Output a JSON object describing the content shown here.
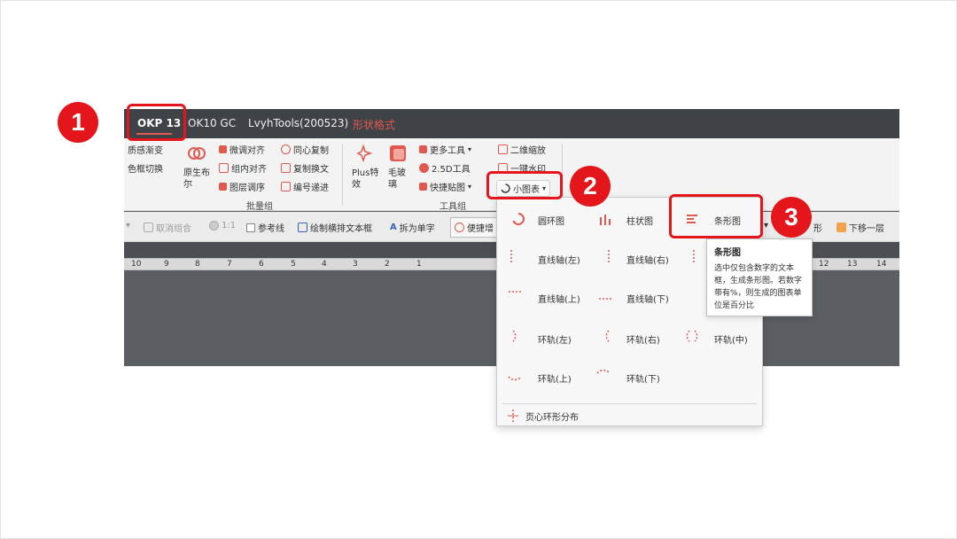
{
  "tabs": {
    "okp": "OKP 13",
    "ok10": "OK10 GC",
    "lvyh": "LvyhTools(200523)",
    "shape": "形状格式"
  },
  "ribbon": {
    "texture": "质感渐变",
    "color_switch": "色框切换",
    "yuansheng": "原生布尔",
    "fine_align": "微调对齐",
    "group_align": "组内对齐",
    "layer_order": "图层调序",
    "concentric_copy": "同心复制",
    "copy_wrap": "复制换文",
    "number_inc": "编号递进",
    "batch_group": "批量组",
    "plus_effect": "Plus特效",
    "frosted": "毛玻璃",
    "more_tools": "更多工具",
    "tool_25d": "2.5D工具",
    "quick_shot": "快捷贴图",
    "qr_zoom": "二维缩放",
    "one_click_watermark": "一键水印",
    "mini_chart": "小图表",
    "tool_group": "工具组"
  },
  "toolbar2": {
    "ungroup": "取消组合",
    "ratio": "1:1",
    "guide": "参考线",
    "draw_textbox": "绘制横排文本框",
    "split_chars": "拆为单字",
    "quick_add": "便捷增",
    "shape_suffix": "形",
    "move_down": "下移一层"
  },
  "ruler": [
    "10",
    "9",
    "8",
    "7",
    "6",
    "5",
    "4",
    "3",
    "2",
    "1",
    "12",
    "13",
    "14"
  ],
  "dropdown": {
    "items": [
      "圆环图",
      "柱状图",
      "条形图",
      "直线轴(左)",
      "直线轴(右)",
      "直线轴(上)",
      "直线轴(下)",
      "环轨(左)",
      "环轨(右)",
      "环轨(中)",
      "环轨(上)",
      "环轨(下)"
    ],
    "footer": "页心环形分布"
  },
  "tooltip": {
    "title": "条形图",
    "desc": "选中仅包含数字的文本框，生成条形图。若数字带有%，则生成的图表单位是百分比"
  },
  "badges": [
    "1",
    "2",
    "3"
  ],
  "colors": {
    "accent": "#e0594e",
    "highlight": "#e5161b"
  }
}
